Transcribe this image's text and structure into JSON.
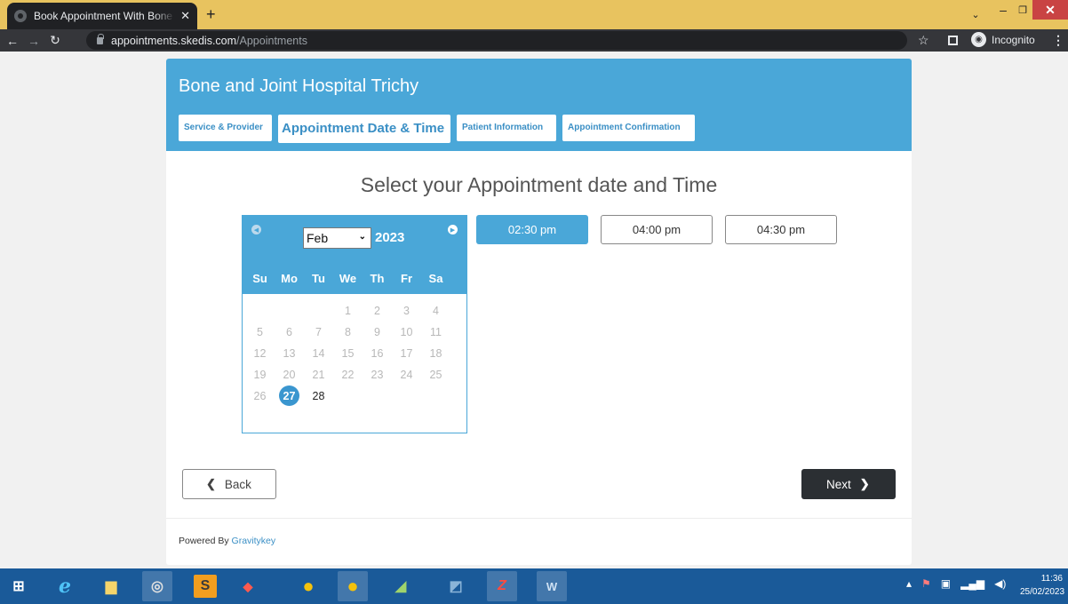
{
  "browser": {
    "tab_title": "Book Appointment With Bone and Joint Hospital Trichy",
    "tab_close": "✕",
    "new_tab": "+",
    "url_host": "appointments.skedis.com",
    "url_path": "/Appointments",
    "incognito_label": "Incognito"
  },
  "header": {
    "hospital_name": "Bone and Joint Hospital Trichy",
    "steps": [
      {
        "label": "Service & Provider"
      },
      {
        "label": "Appointment Date & Time"
      },
      {
        "label": "Patient Information"
      },
      {
        "label": "Appointment Confirmation"
      }
    ]
  },
  "main": {
    "heading": "Select your Appointment date and Time"
  },
  "calendar": {
    "month": "Feb",
    "year": "2023",
    "weekdays": [
      "Su",
      "Mo",
      "Tu",
      "We",
      "Th",
      "Fr",
      "Sa"
    ],
    "leading_blanks": 3,
    "days": [
      "1",
      "2",
      "3",
      "4",
      "5",
      "6",
      "7",
      "8",
      "9",
      "10",
      "11",
      "12",
      "13",
      "14",
      "15",
      "16",
      "17",
      "18",
      "19",
      "20",
      "21",
      "22",
      "23",
      "24",
      "25",
      "26",
      "27",
      "28"
    ],
    "available_days": [
      "27",
      "28"
    ],
    "selected_day": "27"
  },
  "time_slots": [
    {
      "label": "02:30 pm",
      "selected": true
    },
    {
      "label": "04:00 pm",
      "selected": false
    },
    {
      "label": "04:30 pm",
      "selected": false
    }
  ],
  "actions": {
    "back_label": "Back",
    "next_label": "Next"
  },
  "footer": {
    "powered_prefix": "Powered By",
    "powered_link": "Gravitykey"
  },
  "taskbar": {
    "clock_time": "11:36",
    "clock_date": "25/02/2023"
  },
  "colors": {
    "accent": "#4aa7d8",
    "dark_button": "#2b2f33",
    "taskbar": "#1a5a99",
    "tabstrip": "#e8c35f"
  }
}
